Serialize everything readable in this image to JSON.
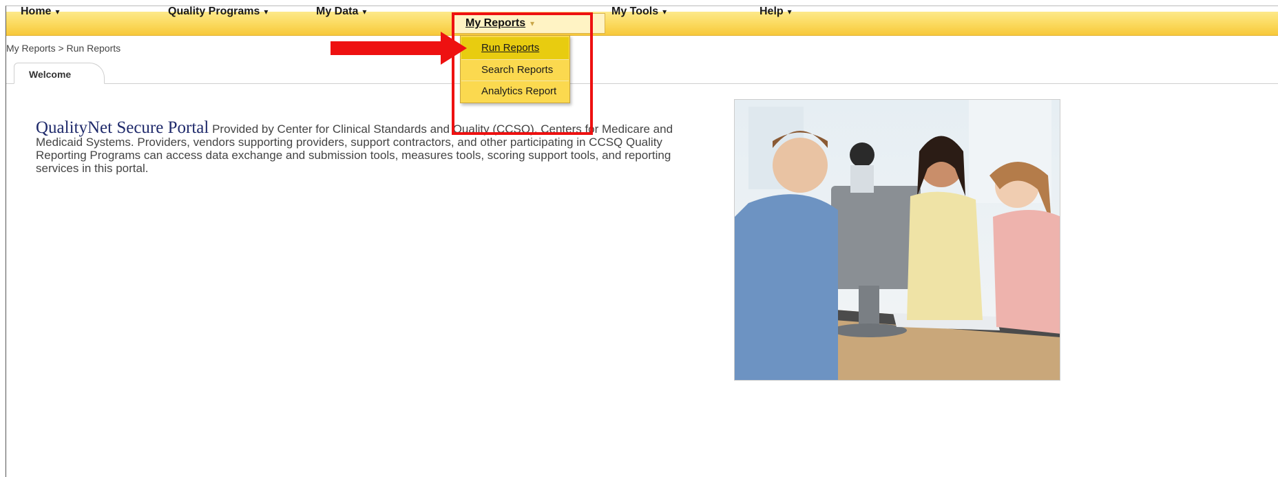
{
  "nav": {
    "home": "Home",
    "quality_programs": "Quality Programs",
    "my_data": "My Data",
    "my_reports": "My Reports",
    "my_tools": "My Tools",
    "help": "Help",
    "caret": "▾"
  },
  "menu": {
    "items": [
      "Run Reports",
      "Search Reports",
      "Analytics Report"
    ],
    "active": "Run Reports"
  },
  "breadcrumb": "My Reports > Run Reports",
  "tab": {
    "label": "Welcome"
  },
  "intro": {
    "title": "QualityNet Secure Portal",
    "body": "Provided by Center for Clinical Standards and Quality (CCSQ), Centers for Medicare and Medicaid Systems. Providers, vendors supporting providers, support contractors, and other participating in CCSQ Quality Reporting Programs can access data exchange and submission tools, measures tools, scoring support tools, and reporting services in this portal."
  },
  "colors": {
    "nav_gold": "#fbd95c",
    "menu_gold": "#fbd94f",
    "menu_active": "#e8cc10",
    "annotation_red": "#ee1111",
    "title_navy": "#1f2a6b"
  }
}
